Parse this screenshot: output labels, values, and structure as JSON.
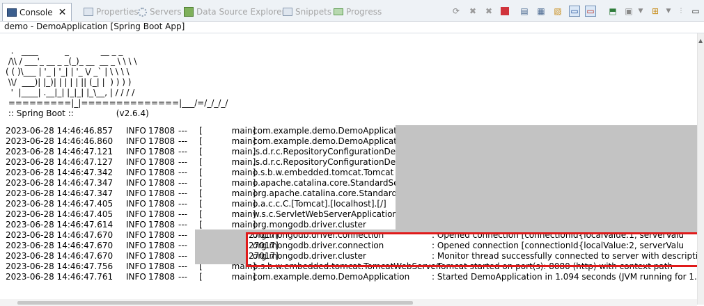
{
  "tabs": [
    {
      "label": "Console",
      "active": true
    },
    {
      "label": "Properties"
    },
    {
      "label": "Servers"
    },
    {
      "label": "Data Source Explorer"
    },
    {
      "label": "Snippets"
    },
    {
      "label": "Progress"
    }
  ],
  "process_title": "demo - DemoApplication [Spring Boot App]",
  "banner": [
    "  .   ____          _            __ _ _",
    " /\\\\ / ___'_ __ _ _(_)_ __  __ _ \\ \\ \\ \\",
    "( ( )\\___ | '_ | '_| | '_ \\/ _` | \\ \\ \\ \\",
    " \\\\/  ___)| |_)| | | | | || (_| |  ) ) ) )",
    "  '  |____| .__|_| |_|_| |_\\__, | / / / /",
    " =========|_|==============|___/=/_/_/_/",
    " :: Spring Boot ::                (v2.6.4)"
  ],
  "logs": [
    {
      "time": "2023-06-28 14:46:46.857",
      "level": "INFO",
      "pid": "17808",
      "sep": "---",
      "thread": "[           main]",
      "logger": "com.example.demo.DemoApplicat",
      "message": ""
    },
    {
      "time": "2023-06-28 14:46:46.860",
      "level": "INFO",
      "pid": "17808",
      "sep": "---",
      "thread": "[           main]",
      "logger": "com.example.demo.DemoApplicat",
      "message": ""
    },
    {
      "time": "2023-06-28 14:46:47.121",
      "level": "INFO",
      "pid": "17808",
      "sep": "---",
      "thread": "[           main]",
      "logger": ".s.d.r.c.RepositoryConfigurationDe",
      "message": ""
    },
    {
      "time": "2023-06-28 14:46:47.127",
      "level": "INFO",
      "pid": "17808",
      "sep": "---",
      "thread": "[           main]",
      "logger": ".s.d.r.c.RepositoryConfigurationDe",
      "message": ""
    },
    {
      "time": "2023-06-28 14:46:47.342",
      "level": "INFO",
      "pid": "17808",
      "sep": "---",
      "thread": "[           main]",
      "logger": "o.s.b.w.embedded.tomcat.Tomcat",
      "message": ""
    },
    {
      "time": "2023-06-28 14:46:47.347",
      "level": "INFO",
      "pid": "17808",
      "sep": "---",
      "thread": "[           main]",
      "logger": "o.apache.catalina.core.StandardSe",
      "message": ""
    },
    {
      "time": "2023-06-28 14:46:47.347",
      "level": "INFO",
      "pid": "17808",
      "sep": "---",
      "thread": "[           main]",
      "logger": "org.apache.catalina.core.Standard",
      "message": ""
    },
    {
      "time": "2023-06-28 14:46:47.405",
      "level": "INFO",
      "pid": "17808",
      "sep": "---",
      "thread": "[           main]",
      "logger": "o.a.c.c.C.[Tomcat].[localhost].[/]",
      "message": ""
    },
    {
      "time": "2023-06-28 14:46:47.405",
      "level": "INFO",
      "pid": "17808",
      "sep": "---",
      "thread": "[           main]",
      "logger": "w.s.c.ServletWebServerApplication",
      "message": ""
    },
    {
      "time": "2023-06-28 14:46:47.614",
      "level": "INFO",
      "pid": "17808",
      "sep": "---",
      "thread": "[           main]",
      "logger": "org.mongodb.driver.cluster",
      "message": ""
    },
    {
      "time": "2023-06-28 14:46:47.670",
      "level": "INFO",
      "pid": "17808",
      "sep": "---",
      "thread": "27017]",
      "logger": "org.mongodb.driver.connection",
      "message": ": Opened connection [connectionId{localValue:1, serverValu"
    },
    {
      "time": "2023-06-28 14:46:47.670",
      "level": "INFO",
      "pid": "17808",
      "sep": "---",
      "thread": "27017]",
      "logger": "org.mongodb.driver.connection",
      "message": ": Opened connection [connectionId{localValue:2, serverValu"
    },
    {
      "time": "2023-06-28 14:46:47.670",
      "level": "INFO",
      "pid": "17808",
      "sep": "---",
      "thread": "27017]",
      "logger": "org.mongodb.driver.cluster",
      "message": ": Monitor thread successfully connected to server with descriptio"
    },
    {
      "time": "2023-06-28 14:46:47.756",
      "level": "INFO",
      "pid": "17808",
      "sep": "---",
      "thread": "[           main]",
      "logger": "o.s.b.w.embedded.tomcat.TomcatWebServer",
      "message": ": Tomcat started on port(s): 8080 (http) with context path"
    },
    {
      "time": "2023-06-28 14:46:47.761",
      "level": "INFO",
      "pid": "17808",
      "sep": "---",
      "thread": "[           main]",
      "logger": "com.example.demo.DemoApplication",
      "message": ": Started DemoApplication in 1.094 seconds (JVM running for 1."
    }
  ],
  "toolbar_icons": [
    "sync-icon",
    "remove-launch-icon",
    "remove-all-terminated-icon",
    "terminate-icon",
    "clear-console-icon",
    "scroll-lock-icon",
    "word-wrap-icon",
    "show-on-stdout-icon",
    "show-on-stderr-icon",
    "pin-console-icon",
    "display-selected-console-icon",
    "open-console-icon",
    "view-menu-icon",
    "minimize-icon"
  ]
}
